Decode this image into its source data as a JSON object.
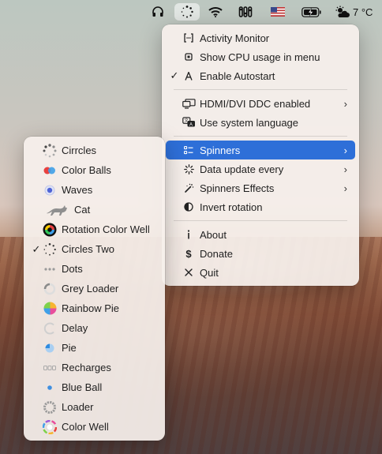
{
  "menubar": {
    "temperature": "7 °C"
  },
  "main_menu": {
    "items": [
      {
        "label": "Activity Monitor",
        "icon": "activity-monitor-icon"
      },
      {
        "label": "Show CPU usage in menu",
        "icon": "cpu-icon"
      },
      {
        "label": "Enable Autostart",
        "icon": "autostart-icon",
        "checked": "✓"
      },
      {
        "label": "HDMI/DVI DDC enabled",
        "icon": "display-icon"
      },
      {
        "label": "Use system language",
        "icon": "language-icon"
      },
      {
        "label": "Spinners",
        "icon": "spinners-icon"
      },
      {
        "label": "Data update every",
        "icon": "update-icon"
      },
      {
        "label": "Spinners Effects",
        "icon": "effects-icon"
      },
      {
        "label": "Invert rotation",
        "icon": "invert-icon"
      },
      {
        "label": "About",
        "icon": "info-icon"
      },
      {
        "label": "Donate",
        "icon": "dollar-icon"
      },
      {
        "label": "Quit",
        "icon": "close-icon"
      }
    ],
    "chevron": "›",
    "selected": "Spinners"
  },
  "spinners_menu": {
    "items": [
      {
        "label": "Cirrcles",
        "icon": "circles-spinner-icon"
      },
      {
        "label": "Color Balls",
        "icon": "color-balls-icon"
      },
      {
        "label": "Waves",
        "icon": "waves-icon"
      },
      {
        "label": "Cat",
        "icon": "cat-icon"
      },
      {
        "label": "Rotation Color Well",
        "icon": "rotation-color-well-icon"
      },
      {
        "label": "Circles Two",
        "icon": "circles-two-icon",
        "checked": "✓"
      },
      {
        "label": "Dots",
        "icon": "dots-icon"
      },
      {
        "label": "Grey Loader",
        "icon": "grey-loader-icon"
      },
      {
        "label": "Rainbow Pie",
        "icon": "rainbow-pie-icon"
      },
      {
        "label": "Delay",
        "icon": "delay-icon"
      },
      {
        "label": "Pie",
        "icon": "pie-icon"
      },
      {
        "label": "Recharges",
        "icon": "recharges-icon"
      },
      {
        "label": "Blue Ball",
        "icon": "blue-ball-icon"
      },
      {
        "label": "Loader",
        "icon": "loader-icon"
      },
      {
        "label": "Color Well",
        "icon": "color-well-icon"
      }
    ]
  },
  "colors": {
    "selection": "#2e6fd8",
    "menu_bg": "#f6f0ec"
  }
}
